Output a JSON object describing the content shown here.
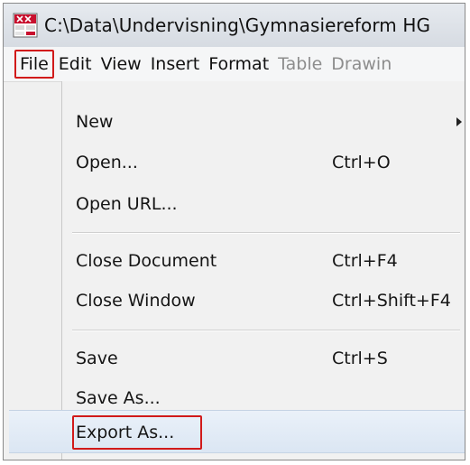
{
  "window": {
    "title": "C:\\Data\\Undervisning\\Gymnasiereform HG",
    "app_icon": "spreadsheet-app-icon"
  },
  "menubar": {
    "items": [
      {
        "label": "File",
        "enabled": true,
        "highlighted": true
      },
      {
        "label": "Edit",
        "enabled": true
      },
      {
        "label": "View",
        "enabled": true
      },
      {
        "label": "Insert",
        "enabled": true
      },
      {
        "label": "Format",
        "enabled": true
      },
      {
        "label": "Table",
        "enabled": false
      },
      {
        "label": "Drawin",
        "enabled": false
      }
    ]
  },
  "file_menu": {
    "items": [
      {
        "label": "New",
        "shortcut": "",
        "submenu": true
      },
      {
        "label": "Open...",
        "shortcut": "Ctrl+O"
      },
      {
        "label": "Open URL...",
        "shortcut": ""
      },
      {
        "label": "Close Document",
        "shortcut": "Ctrl+F4"
      },
      {
        "label": "Close Window",
        "shortcut": "Ctrl+Shift+F4"
      },
      {
        "label": "Save",
        "shortcut": "Ctrl+S"
      },
      {
        "label": "Save As...",
        "shortcut": ""
      },
      {
        "label": "Export As...",
        "shortcut": "",
        "hovered": true,
        "highlighted": true
      }
    ]
  },
  "colors": {
    "highlight_border": "#d11a1a",
    "hover_bg": "#dbe6f3",
    "disabled_text": "#8d8d8d"
  }
}
